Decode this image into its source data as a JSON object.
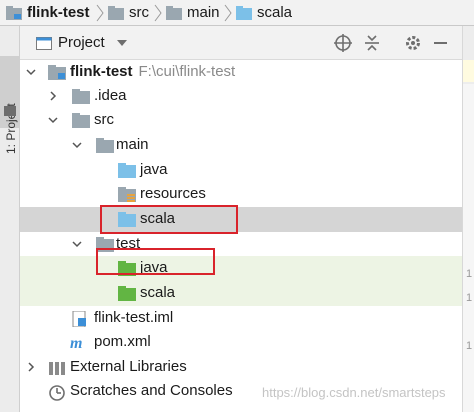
{
  "breadcrumb": [
    "flink-test",
    "src",
    "main",
    "scala"
  ],
  "side_tab": {
    "label": "1: Project"
  },
  "panel": {
    "title": "Project"
  },
  "tree": {
    "root_label": "flink-test",
    "root_path": "F:\\cui\\flink-test",
    "idea": ".idea",
    "src": "src",
    "main": "main",
    "java": "java",
    "resources": "resources",
    "scala": "scala",
    "test": "test",
    "test_java": "java",
    "test_scala": "scala",
    "iml": "flink-test.iml",
    "pom": "pom.xml",
    "ext_libs": "External Libraries",
    "scratches": "Scratches and Consoles"
  },
  "gutter": [
    "1",
    "1",
    "1"
  ],
  "watermark": "https://blog.csdn.net/smartsteps",
  "colors": {
    "selection": "#d5d5d5",
    "test_bg": "#edf4e4",
    "highlight_box": "#d9232b",
    "folder_blue": "#7cc0e8",
    "folder_gray": "#9aa7b0",
    "folder_green": "#62b543"
  }
}
